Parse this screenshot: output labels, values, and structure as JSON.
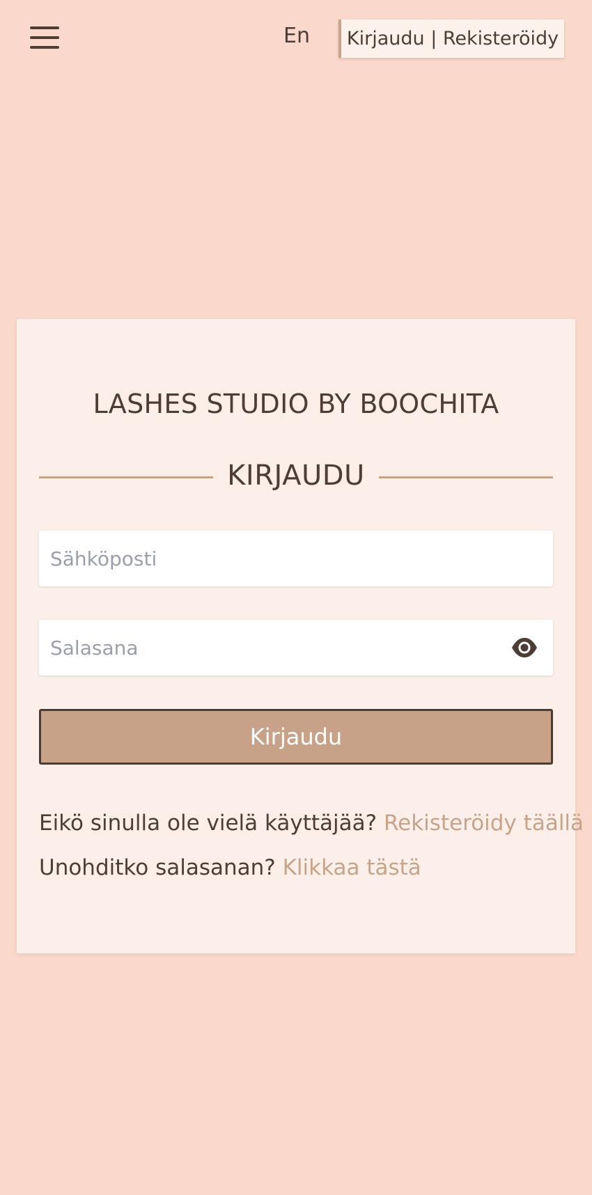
{
  "header": {
    "menu_icon": "hamburger-menu-icon",
    "language": "En",
    "auth_link": "Kirjaudu | Rekisteröidy"
  },
  "login_card": {
    "studio_name": "LASHES STUDIO BY BOOCHITA",
    "heading": "KIRJAUDU",
    "email_placeholder": "Sähköposti",
    "email_value": "",
    "password_placeholder": "Salasana",
    "password_value": "",
    "password_toggle_icon": "eye-icon",
    "submit_label": "Kirjaudu",
    "register_prompt": "Eikö sinulla ole vielä käyttäjää?",
    "register_link": "Rekisteröidy täällä",
    "forgot_prompt": "Unohditko salasanan?",
    "forgot_link": "Klikkaa tästä"
  },
  "colors": {
    "background": "#fad8cb",
    "card": "#fcefea",
    "accent": "#c7a489",
    "text": "#4e3d35",
    "button": "#c8a288"
  }
}
